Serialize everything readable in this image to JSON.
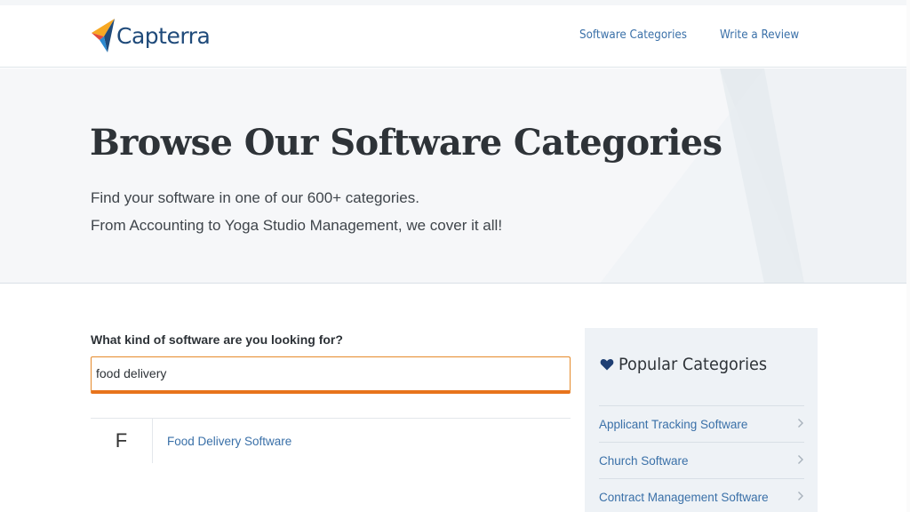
{
  "header": {
    "logo_text": "Capterra",
    "nav": [
      {
        "label": "Software Categories"
      },
      {
        "label": "Write a Review"
      }
    ]
  },
  "hero": {
    "title": "Browse Our Software Categories",
    "subtitle_line1": "Find your software in one of our 600+ categories.",
    "subtitle_line2": "From Accounting to Yoga Studio Management, we cover it all!"
  },
  "search": {
    "label": "What kind of software are you looking for?",
    "value": "food delivery"
  },
  "results": [
    {
      "letter": "F",
      "label": "Food Delivery Software"
    }
  ],
  "popular": {
    "title": "Popular Categories",
    "icon": "heart-icon",
    "items": [
      {
        "label": "Applicant Tracking Software"
      },
      {
        "label": "Church Software"
      },
      {
        "label": "Contract Management Software"
      }
    ]
  },
  "colors": {
    "brand_navy": "#1f4a7a",
    "link_blue": "#3a70a8",
    "search_orange": "#e8731c",
    "panel_bg": "#eef2f6"
  }
}
